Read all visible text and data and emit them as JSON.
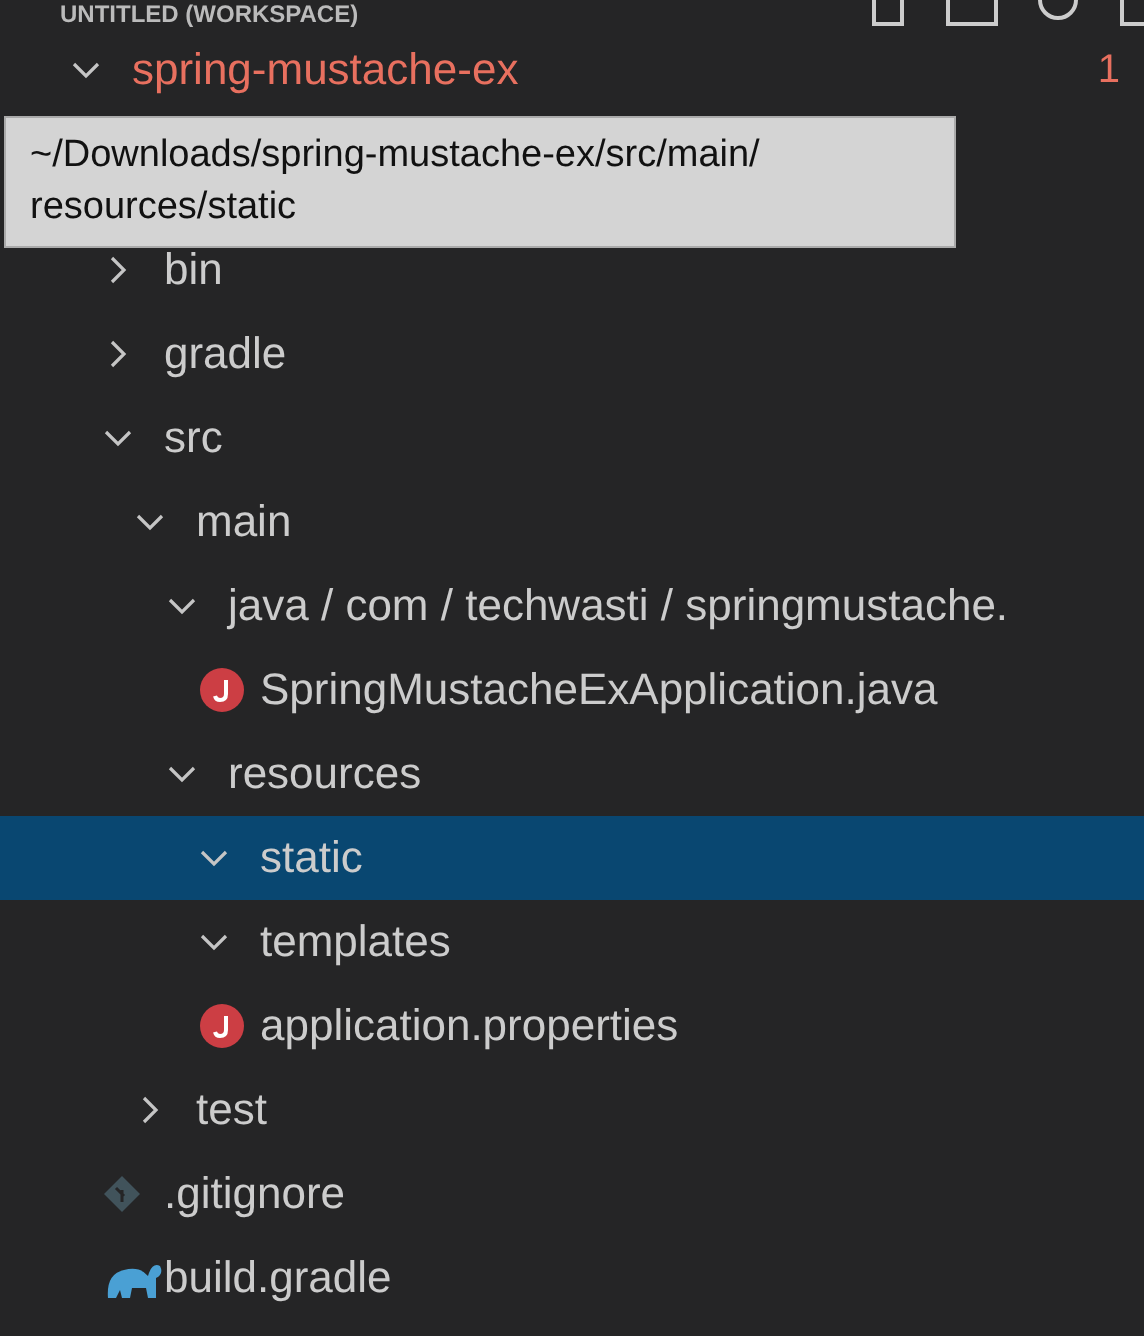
{
  "header": {
    "title": "UNTITLED (WORKSPACE)"
  },
  "tooltip": {
    "text": "~/Downloads/spring-mustache-ex/src/main/ resources/static"
  },
  "tree": [
    {
      "label": "spring-mustache-ex",
      "kind": "folder",
      "expanded": true,
      "selected": false,
      "modified": true,
      "badge": "1",
      "children": [
        {
          "label": "bin",
          "kind": "folder",
          "expanded": false,
          "selected": false
        },
        {
          "label": "gradle",
          "kind": "folder",
          "expanded": false,
          "selected": false
        },
        {
          "label": "src",
          "kind": "folder",
          "expanded": true,
          "selected": false,
          "children": [
            {
              "label": "main",
              "kind": "folder",
              "expanded": true,
              "selected": false,
              "children": [
                {
                  "label": "java / com / techwasti / springmustache.",
                  "kind": "folder",
                  "expanded": true,
                  "selected": false,
                  "children": [
                    {
                      "label": "SpringMustacheExApplication.java",
                      "kind": "java",
                      "selected": false
                    }
                  ]
                },
                {
                  "label": "resources",
                  "kind": "folder",
                  "expanded": true,
                  "selected": false,
                  "children": [
                    {
                      "label": "static",
                      "kind": "folder",
                      "expanded": true,
                      "selected": true
                    },
                    {
                      "label": "templates",
                      "kind": "folder",
                      "expanded": true,
                      "selected": false
                    },
                    {
                      "label": "application.properties",
                      "kind": "java",
                      "selected": false
                    }
                  ]
                }
              ]
            },
            {
              "label": "test",
              "kind": "folder",
              "expanded": false,
              "selected": false
            }
          ]
        },
        {
          "label": ".gitignore",
          "kind": "git",
          "selected": false
        },
        {
          "label": "build.gradle",
          "kind": "gradle",
          "selected": false
        }
      ]
    }
  ]
}
